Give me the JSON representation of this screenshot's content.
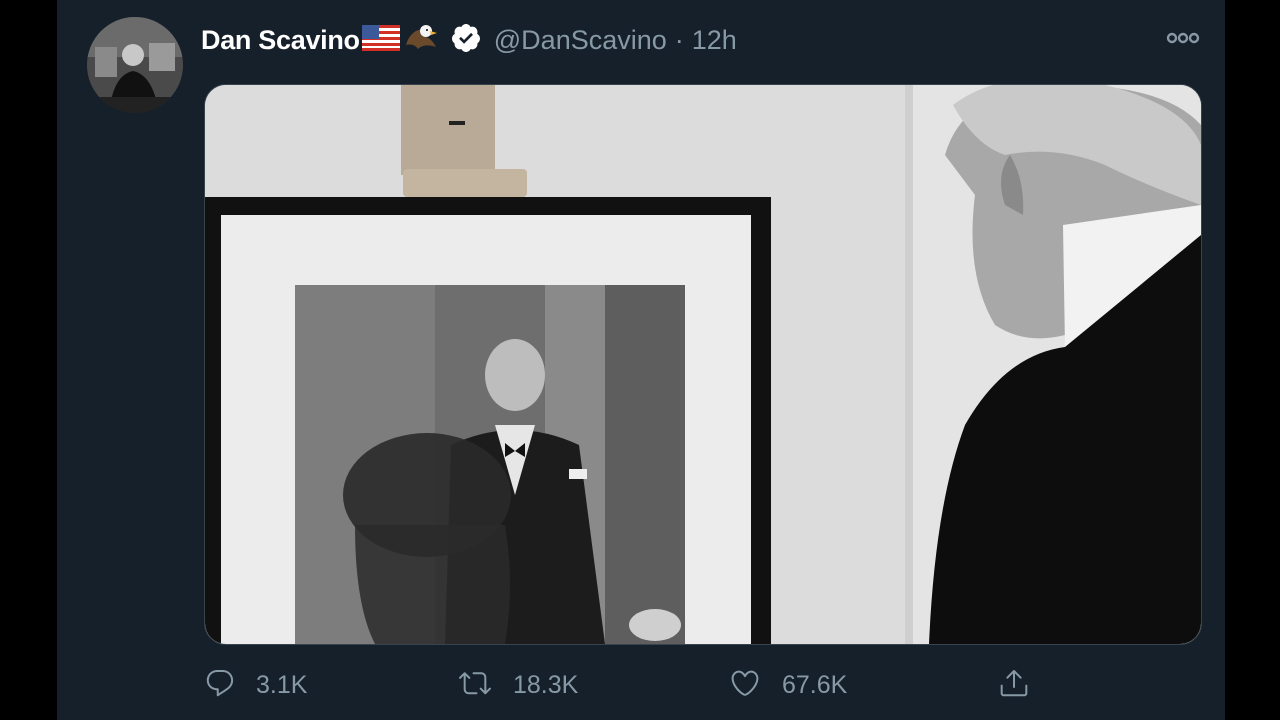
{
  "tweet": {
    "author": {
      "display_name": "Dan Scavino",
      "emojis": [
        "us-flag",
        "eagle"
      ],
      "verified": true,
      "handle": "@DanScavino"
    },
    "separator": "·",
    "timestamp": "12h",
    "media": {
      "type": "black-and-white photo",
      "subject": "man in suit viewing framed portrait on easel"
    },
    "actions": {
      "reply_count": "3.1K",
      "retweet_count": "18.3K",
      "like_count": "67.6K"
    }
  },
  "icons": {
    "more": "more-icon",
    "verified": "verified-badge-icon",
    "reply": "reply-icon",
    "retweet": "retweet-icon",
    "like": "heart-icon",
    "share": "share-icon"
  },
  "colors": {
    "background": "#15202b",
    "secondary_text": "#8899a6",
    "primary_text": "#ffffff",
    "border": "#38444d"
  }
}
